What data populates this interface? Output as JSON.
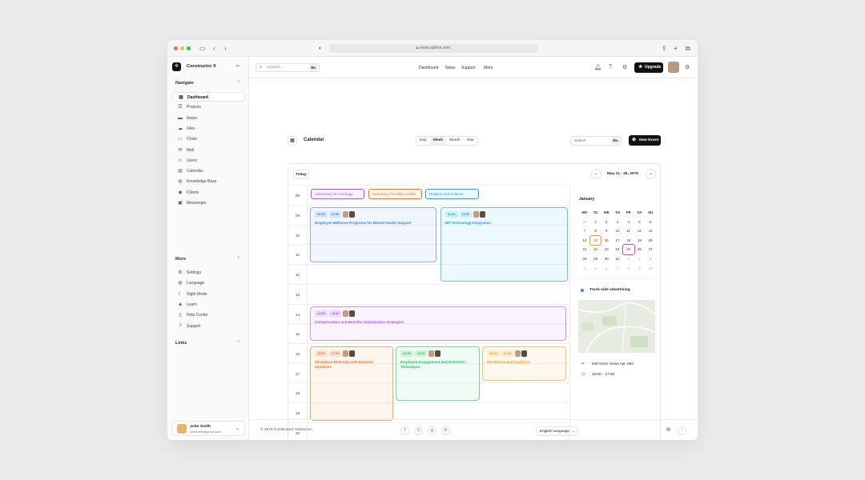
{
  "browser": {
    "url": "www.spline.one"
  },
  "sidebar": {
    "app_name": "Constructor X",
    "nav_title": "Navigate",
    "more_title": "More",
    "links_title": "Links",
    "nav": [
      {
        "label": "Dashboard",
        "icon": "grid-icon"
      },
      {
        "label": "Projects",
        "icon": "list-icon"
      },
      {
        "label": "Notes",
        "icon": "folder-icon"
      },
      {
        "label": "Files",
        "icon": "cloud-icon"
      },
      {
        "label": "Chats",
        "icon": "chat-icon"
      },
      {
        "label": "Mail",
        "icon": "mail-icon"
      },
      {
        "label": "Users",
        "icon": "users-icon"
      },
      {
        "label": "Calendar",
        "icon": "calendar-icon"
      },
      {
        "label": "Knowledge Base",
        "icon": "globe-icon"
      },
      {
        "label": "Clients",
        "icon": "clients-icon"
      },
      {
        "label": "Messenger",
        "icon": "messenger-icon"
      }
    ],
    "more": [
      {
        "label": "Settings",
        "icon": "gear-icon"
      },
      {
        "label": "Language",
        "icon": "globe-icon"
      },
      {
        "label": "Night Mode",
        "icon": "moon-icon"
      },
      {
        "label": "Learn",
        "icon": "learn-icon"
      },
      {
        "label": "Help Center",
        "icon": "doc-icon"
      },
      {
        "label": "Support",
        "icon": "help-icon"
      }
    ],
    "user": {
      "name": "John Smith",
      "email": "johnsmith@gmail.com"
    }
  },
  "topbar": {
    "search_placeholder": "Search...",
    "shortcut": "⌘K",
    "links": [
      "Dashboard",
      "News",
      "Support",
      "More"
    ],
    "upgrade": "Upgrade"
  },
  "page": {
    "title": "Calendar",
    "views": [
      "Day",
      "Week",
      "Month",
      "Year"
    ],
    "search_placeholder": "Search",
    "shortcut": "⌘K",
    "new_event": "New Event"
  },
  "calendar": {
    "today": "Today",
    "range": "May 21 - 26, 2076",
    "hours": [
      "09",
      "10",
      "11",
      "12",
      "13",
      "14",
      "15",
      "16",
      "17",
      "18",
      "19",
      "20"
    ],
    "allday_label": "09",
    "allday": [
      {
        "title": "Astronomy Or Astrology",
        "color": "#a855f7"
      },
      {
        "title": "Unlocking The Bible Codes",
        "color": "#f97316"
      },
      {
        "title": "Religion And Science",
        "color": "#0ea5e9"
      }
    ],
    "events": [
      {
        "title": "Employee Wellness Programs for Mental Health Support",
        "start": "09:00",
        "end": "11:00",
        "color": "#3b82f6"
      },
      {
        "title": "HR Technology Integration",
        "start": "11:00",
        "end": "13:00",
        "color": "#0ea5e9"
      },
      {
        "title": "Compensation and Benefits Optimization Strategies",
        "start": "14:00",
        "end": "15:40",
        "color": "#a855f7"
      },
      {
        "title": "Workplace Diversity and Inclusion Initiatives",
        "start": "16:30",
        "end": "17:30",
        "color": "#f97316"
      },
      {
        "title": "Employee Engagement and Retention Techniques",
        "start": "16:00",
        "end": "16:50",
        "color": "#22c55e"
      },
      {
        "title": "HR Metrics and Analytics",
        "start": "16:30",
        "end": "17:50",
        "color": "#f59e0b"
      }
    ]
  },
  "mini_calendar": {
    "month": "January",
    "weekdays": [
      "MO",
      "TU",
      "WE",
      "TH",
      "FR",
      "SA",
      "SU"
    ],
    "days": [
      "31",
      "1",
      "2",
      "3",
      "4",
      "5",
      "6",
      "7",
      "8",
      "9",
      "10",
      "11",
      "12",
      "13",
      "14",
      "15",
      "16",
      "17",
      "18",
      "19",
      "20",
      "21",
      "22",
      "23",
      "24",
      "25",
      "26",
      "27",
      "28",
      "29",
      "30",
      "31",
      "1",
      "2",
      "3",
      "4",
      "5",
      "6",
      "7",
      "8",
      "9",
      "10"
    ],
    "today": "15",
    "selected": "25"
  },
  "event_detail": {
    "title": "Truck side advertising",
    "address": "540 Orion Views Apt. 592",
    "time": "16:50 – 17:50"
  },
  "footer": {
    "copyright": "© 2076 Constructor Global Inc.",
    "language": "English Language"
  }
}
